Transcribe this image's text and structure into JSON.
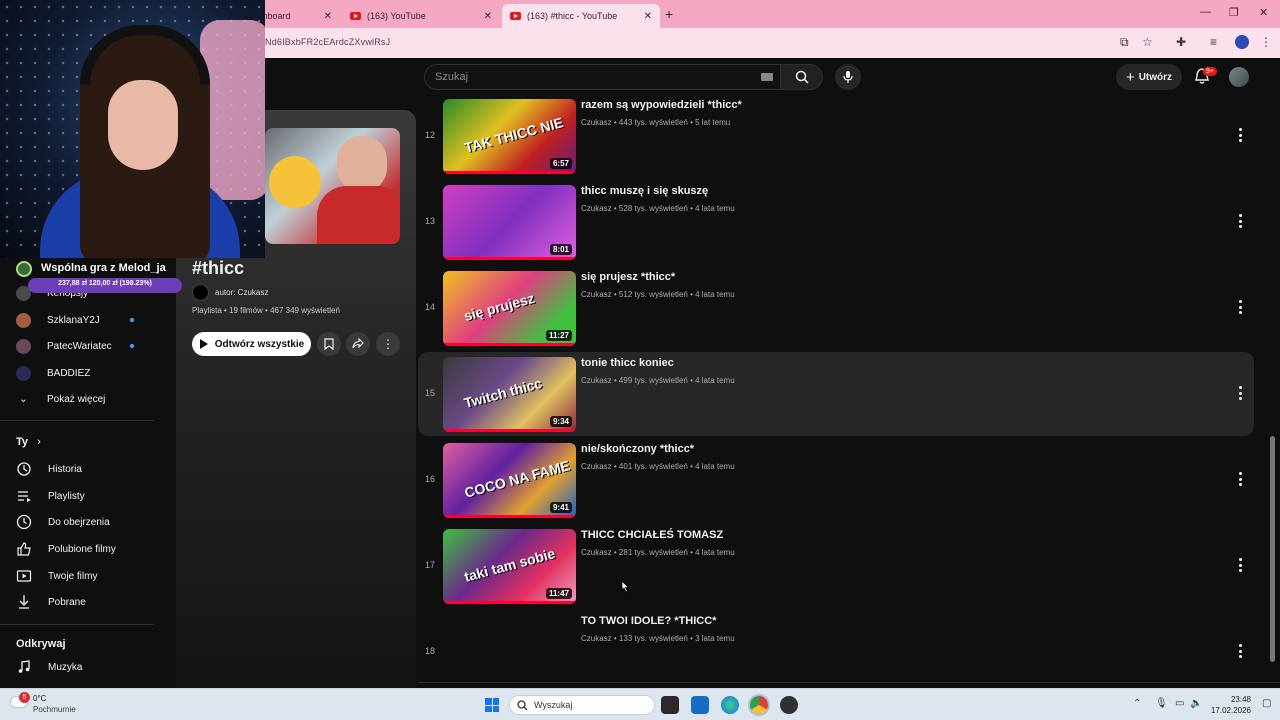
{
  "browser": {
    "tabs": [
      {
        "label": "shboard",
        "active": false
      },
      {
        "label": "(163) YouTube",
        "active": false
      },
      {
        "label": "(163) #thicc - YouTube",
        "active": true
      }
    ],
    "url": "Nd6IBxbFR2cEArdcZXvwlRsJ"
  },
  "youtube_header": {
    "search_placeholder": "Szukaj",
    "create_label": "Utwórz",
    "notifications_badge": "9+"
  },
  "stream_overlay": {
    "goal_title": "Wspólna gra z Melod_ja",
    "goal_progress_text": "237,88 zł   120,00 zł (198.23%)",
    "goal_percent": 100
  },
  "sidebar": {
    "subscriptions": [
      {
        "name": "Kenopsjy",
        "color": "#4a4a4a",
        "live": false
      },
      {
        "name": "SzklanaY2J",
        "color": "#a06040",
        "live": true
      },
      {
        "name": "PatecWariatec",
        "color": "#6a4a5a",
        "live": true
      },
      {
        "name": "BADDIEZ",
        "color": "#2a2a5a",
        "live": false
      }
    ],
    "show_more": "Pokaż więcej",
    "you_title": "Ty",
    "you_items": [
      {
        "label": "Historia",
        "icon": "history-icon"
      },
      {
        "label": "Playlisty",
        "icon": "playlists-icon"
      },
      {
        "label": "Do obejrzenia",
        "icon": "watch-later-icon"
      },
      {
        "label": "Polubione filmy",
        "icon": "liked-icon"
      },
      {
        "label": "Twoje filmy",
        "icon": "your-videos-icon"
      },
      {
        "label": "Pobrane",
        "icon": "downloads-icon"
      }
    ],
    "explore_title": "Odkrywaj",
    "explore_items": [
      {
        "label": "Muzyka",
        "icon": "music-icon"
      }
    ]
  },
  "playlist": {
    "title": "#thicc",
    "author": "autor: Czukasz",
    "meta": "Playlista • 19 filmów • 467 349 wyświetleń",
    "play_all": "Odtwórz wszystkie"
  },
  "videos": [
    {
      "index": "12",
      "title": "razem są wypowiedzieli *thicc*",
      "meta": "Czukasz • 443 tys. wyświetleń • 5 lat temu",
      "duration": "6:57",
      "highlighted": false
    },
    {
      "index": "13",
      "title": "thicc muszę i się skuszę",
      "meta": "Czukasz • 528 tys. wyświetleń • 4 lata temu",
      "duration": "8:01",
      "highlighted": false
    },
    {
      "index": "14",
      "title": "się prujesz *thicc*",
      "meta": "Czukasz • 512 tys. wyświetleń • 4 lata temu",
      "duration": "11:27",
      "highlighted": false
    },
    {
      "index": "15",
      "title": "tonie thicc koniec",
      "meta": "Czukasz • 499 tys. wyświetleń • 4 lata temu",
      "duration": "9:34",
      "highlighted": true
    },
    {
      "index": "16",
      "title": "nie/skończony *thicc*",
      "meta": "Czukasz • 401 tys. wyświetleń • 4 lata temu",
      "duration": "9:41",
      "highlighted": false
    },
    {
      "index": "17",
      "title": "THICC CHCIAŁEŚ TOMASZ",
      "meta": "Czukasz • 281 tys. wyświetleń • 4 lata temu",
      "duration": "11:47",
      "highlighted": false
    },
    {
      "index": "18",
      "title": "TO TWOI IDOLE? *THICC*",
      "meta": "Czukasz • 133 tys. wyświetleń • 3 lata temu",
      "duration": "",
      "highlighted": false
    }
  ],
  "thumb_texts": {
    "t12": "TAK THICC NIE",
    "t14": "się prujesz",
    "t15": "Twitch thicc",
    "t16": "COCO NA FAME",
    "t17": "taki tam sobie"
  },
  "taskbar": {
    "weather_temp": "0°C",
    "weather_cond": "Pochmurnie",
    "weather_badge": "5",
    "search_placeholder": "Wyszukaj",
    "time": "23:48",
    "date": "17.02.2026"
  }
}
